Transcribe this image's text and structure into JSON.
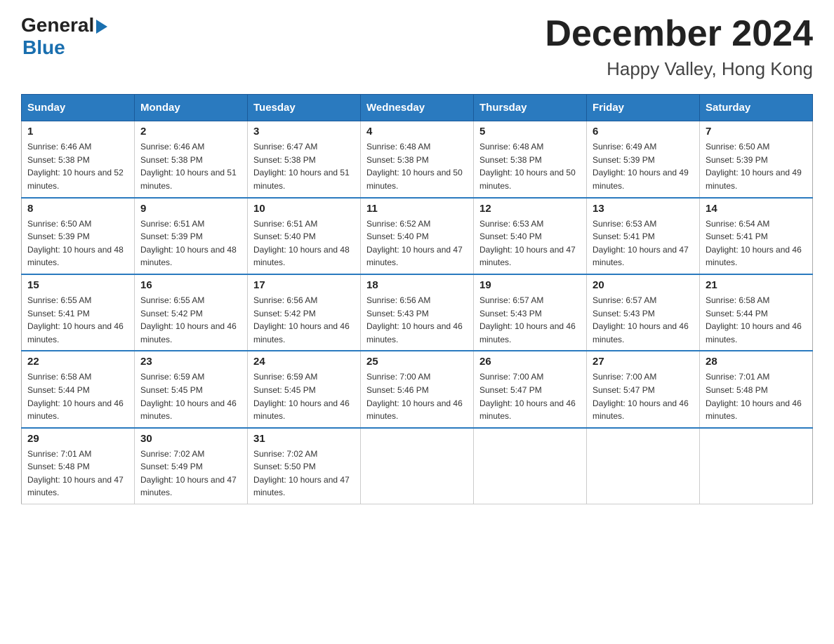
{
  "header": {
    "logo_general": "General",
    "logo_blue": "Blue",
    "month_year": "December 2024",
    "location": "Happy Valley, Hong Kong"
  },
  "weekdays": [
    "Sunday",
    "Monday",
    "Tuesday",
    "Wednesday",
    "Thursday",
    "Friday",
    "Saturday"
  ],
  "weeks": [
    [
      {
        "day": "1",
        "sunrise": "6:46 AM",
        "sunset": "5:38 PM",
        "daylight": "10 hours and 52 minutes."
      },
      {
        "day": "2",
        "sunrise": "6:46 AM",
        "sunset": "5:38 PM",
        "daylight": "10 hours and 51 minutes."
      },
      {
        "day": "3",
        "sunrise": "6:47 AM",
        "sunset": "5:38 PM",
        "daylight": "10 hours and 51 minutes."
      },
      {
        "day": "4",
        "sunrise": "6:48 AM",
        "sunset": "5:38 PM",
        "daylight": "10 hours and 50 minutes."
      },
      {
        "day": "5",
        "sunrise": "6:48 AM",
        "sunset": "5:38 PM",
        "daylight": "10 hours and 50 minutes."
      },
      {
        "day": "6",
        "sunrise": "6:49 AM",
        "sunset": "5:39 PM",
        "daylight": "10 hours and 49 minutes."
      },
      {
        "day": "7",
        "sunrise": "6:50 AM",
        "sunset": "5:39 PM",
        "daylight": "10 hours and 49 minutes."
      }
    ],
    [
      {
        "day": "8",
        "sunrise": "6:50 AM",
        "sunset": "5:39 PM",
        "daylight": "10 hours and 48 minutes."
      },
      {
        "day": "9",
        "sunrise": "6:51 AM",
        "sunset": "5:39 PM",
        "daylight": "10 hours and 48 minutes."
      },
      {
        "day": "10",
        "sunrise": "6:51 AM",
        "sunset": "5:40 PM",
        "daylight": "10 hours and 48 minutes."
      },
      {
        "day": "11",
        "sunrise": "6:52 AM",
        "sunset": "5:40 PM",
        "daylight": "10 hours and 47 minutes."
      },
      {
        "day": "12",
        "sunrise": "6:53 AM",
        "sunset": "5:40 PM",
        "daylight": "10 hours and 47 minutes."
      },
      {
        "day": "13",
        "sunrise": "6:53 AM",
        "sunset": "5:41 PM",
        "daylight": "10 hours and 47 minutes."
      },
      {
        "day": "14",
        "sunrise": "6:54 AM",
        "sunset": "5:41 PM",
        "daylight": "10 hours and 46 minutes."
      }
    ],
    [
      {
        "day": "15",
        "sunrise": "6:55 AM",
        "sunset": "5:41 PM",
        "daylight": "10 hours and 46 minutes."
      },
      {
        "day": "16",
        "sunrise": "6:55 AM",
        "sunset": "5:42 PM",
        "daylight": "10 hours and 46 minutes."
      },
      {
        "day": "17",
        "sunrise": "6:56 AM",
        "sunset": "5:42 PM",
        "daylight": "10 hours and 46 minutes."
      },
      {
        "day": "18",
        "sunrise": "6:56 AM",
        "sunset": "5:43 PM",
        "daylight": "10 hours and 46 minutes."
      },
      {
        "day": "19",
        "sunrise": "6:57 AM",
        "sunset": "5:43 PM",
        "daylight": "10 hours and 46 minutes."
      },
      {
        "day": "20",
        "sunrise": "6:57 AM",
        "sunset": "5:43 PM",
        "daylight": "10 hours and 46 minutes."
      },
      {
        "day": "21",
        "sunrise": "6:58 AM",
        "sunset": "5:44 PM",
        "daylight": "10 hours and 46 minutes."
      }
    ],
    [
      {
        "day": "22",
        "sunrise": "6:58 AM",
        "sunset": "5:44 PM",
        "daylight": "10 hours and 46 minutes."
      },
      {
        "day": "23",
        "sunrise": "6:59 AM",
        "sunset": "5:45 PM",
        "daylight": "10 hours and 46 minutes."
      },
      {
        "day": "24",
        "sunrise": "6:59 AM",
        "sunset": "5:45 PM",
        "daylight": "10 hours and 46 minutes."
      },
      {
        "day": "25",
        "sunrise": "7:00 AM",
        "sunset": "5:46 PM",
        "daylight": "10 hours and 46 minutes."
      },
      {
        "day": "26",
        "sunrise": "7:00 AM",
        "sunset": "5:47 PM",
        "daylight": "10 hours and 46 minutes."
      },
      {
        "day": "27",
        "sunrise": "7:00 AM",
        "sunset": "5:47 PM",
        "daylight": "10 hours and 46 minutes."
      },
      {
        "day": "28",
        "sunrise": "7:01 AM",
        "sunset": "5:48 PM",
        "daylight": "10 hours and 46 minutes."
      }
    ],
    [
      {
        "day": "29",
        "sunrise": "7:01 AM",
        "sunset": "5:48 PM",
        "daylight": "10 hours and 47 minutes."
      },
      {
        "day": "30",
        "sunrise": "7:02 AM",
        "sunset": "5:49 PM",
        "daylight": "10 hours and 47 minutes."
      },
      {
        "day": "31",
        "sunrise": "7:02 AM",
        "sunset": "5:50 PM",
        "daylight": "10 hours and 47 minutes."
      },
      null,
      null,
      null,
      null
    ]
  ]
}
